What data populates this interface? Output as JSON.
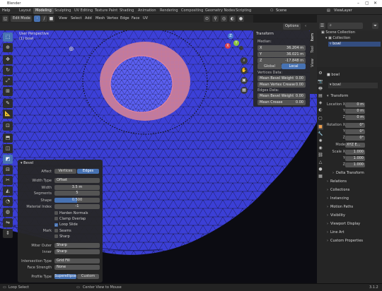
{
  "window": {
    "title": "Blender",
    "controls": [
      "–",
      "▢",
      "✕"
    ]
  },
  "topbar": {
    "menus": [
      "File",
      "Edit",
      "Render",
      "Window",
      "Help"
    ],
    "workspaces": [
      "Layout",
      "Modeling",
      "Sculpting",
      "UV Editing",
      "Texture Paint",
      "Shading",
      "Animation",
      "Rendering",
      "Compositing",
      "Geometry Nodes",
      "Scripting"
    ],
    "active_workspace": "Modeling",
    "scene_label": "Scene",
    "viewlayer_label": "ViewLayer"
  },
  "viewport_header": {
    "mode": "Edit Mode",
    "menus": [
      "View",
      "Select",
      "Add",
      "Mesh",
      "Vertex",
      "Edge",
      "Face",
      "UV"
    ],
    "transform_space": "Global",
    "options": "Options"
  },
  "viewport": {
    "view_name": "User Perspective",
    "object_name": "(1) bowl",
    "gizmo": {
      "x": "X",
      "y": "Y",
      "z": "Z"
    },
    "colors": {
      "mesh_face": "#3b3fd6",
      "mesh_dark": "#2d30b8",
      "wire": "#1a1a1a",
      "selected_edge": "#ff9a5a",
      "background": "#0c0c12"
    }
  },
  "npanel": {
    "title": "Transform",
    "median_label": "Median:",
    "fields": [
      {
        "k": "X",
        "v": "36.204 m"
      },
      {
        "k": "Y",
        "v": "36.021 m"
      },
      {
        "k": "Z",
        "v": "-17.848 m"
      }
    ],
    "toggle_global": "Global",
    "toggle_local": "Local",
    "vertices_label": "Vertices Data:",
    "vert_bevel": {
      "k": "Mean Bevel Weight",
      "v": "0.00"
    },
    "vert_crease": {
      "k": "Mean Vertex Crease",
      "v": "0.00"
    },
    "edges_label": "Edges Data:",
    "edge_bevel": {
      "k": "Mean Bevel Weight",
      "v": "0.00"
    },
    "edge_crease": {
      "k": "Mean Crease",
      "v": "0.00"
    },
    "tabs": [
      "Item",
      "Tool",
      "View"
    ]
  },
  "bevel": {
    "title": "Bevel",
    "affect_label": "Affect",
    "affect_vertices": "Vertices",
    "affect_edges": "Edges",
    "width_type_label": "Width Type",
    "width_type": "Offset",
    "width_label": "Width",
    "width": "3.5 m",
    "segments_label": "Segments",
    "segments": "5",
    "shape_label": "Shape",
    "shape": "0.500",
    "shape_value": 0.5,
    "material_label": "Material Index",
    "material": "-1",
    "harden_normals": "Harden Normals",
    "clamp_overlap": "Clamp Overlap",
    "loop_slide": "Loop Slide",
    "mark_label": "Mark",
    "seams": "Seams",
    "sharp": "Sharp",
    "miter_outer_label": "Miter Outer",
    "miter_outer": "Sharp",
    "inner_label": "Inner",
    "inner": "Sharp",
    "intersection_label": "Intersection Type",
    "intersection": "Grid Fill",
    "face_strength_label": "Face Strength",
    "face_strength": "None",
    "profile_label": "Profile Type",
    "profile_superellipse": "Superellipse",
    "profile_custom": "Custom"
  },
  "outliner": {
    "title": "Scene Collection",
    "rows": [
      "Scene Collection",
      "Collection",
      "bowl"
    ]
  },
  "properties": {
    "object_name": "bowl",
    "object_data": "bowl",
    "transform_label": "Transform",
    "location_label": "Location",
    "loc": {
      "x": "0 m",
      "y": "0 m",
      "z": "0 m"
    },
    "rotation_label": "Rotation",
    "rot": {
      "x": "0°",
      "y": "0°",
      "z": "0°"
    },
    "mode_label": "Mode",
    "mode": "XYZ E...",
    "scale_x_label": "Scale X",
    "scale": {
      "x": "1.000",
      "y": "1.000",
      "z": "1.000"
    },
    "axis": {
      "x": "X",
      "y": "Y",
      "z": "Z"
    },
    "sections": [
      "Delta Transform",
      "Relations",
      "Collections",
      "Instancing",
      "Motion Paths",
      "Visibility",
      "Viewport Display",
      "Line Art",
      "Custom Properties"
    ]
  },
  "statusbar": {
    "left": "Loop Select",
    "middle": "Center View to Mouse",
    "version": "3.1.2"
  }
}
